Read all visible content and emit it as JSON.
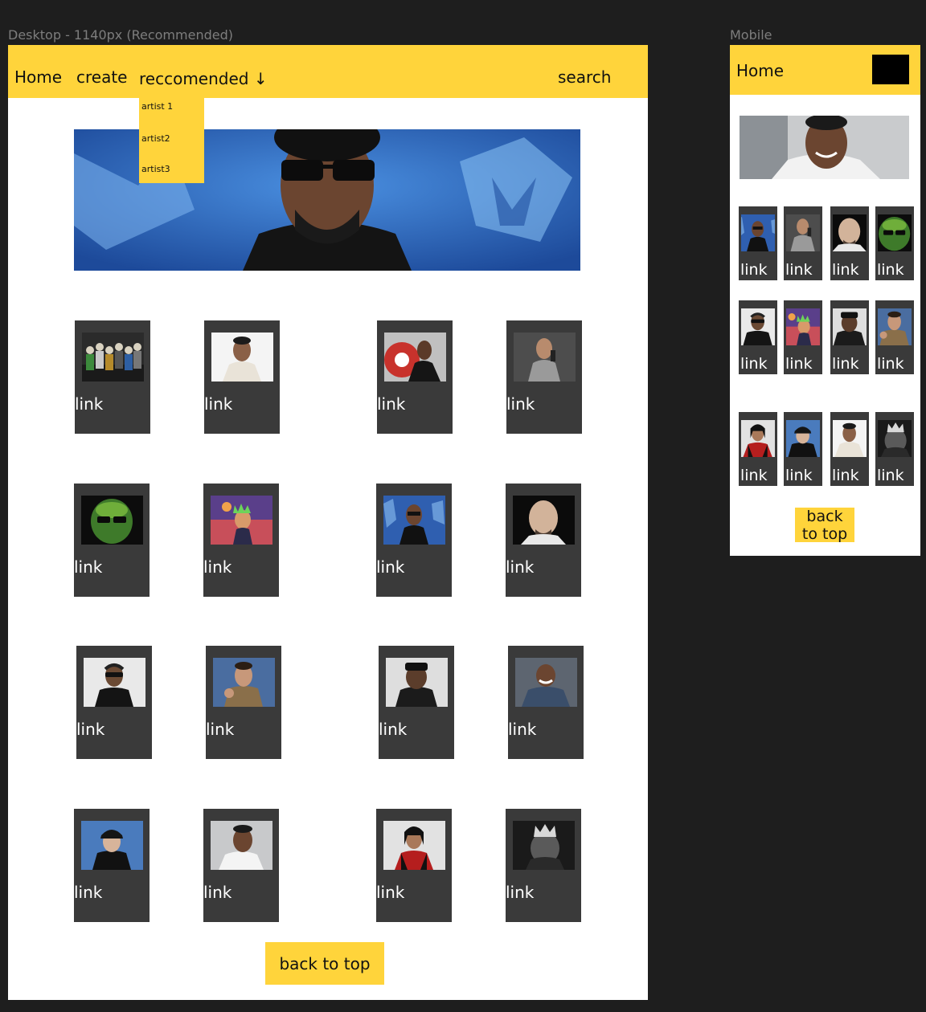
{
  "canvas": {
    "desktop_label": "Desktop - 1140px (Recommended)",
    "mobile_label": "Mobile"
  },
  "desktop": {
    "nav": {
      "home": "Home",
      "create": "create",
      "recommended": "reccomended ↓",
      "search": "search"
    },
    "dropdown": [
      "artist 1",
      "artist2",
      "artist3"
    ],
    "link_label": "link",
    "back_to_top": "back to top"
  },
  "mobile": {
    "nav": {
      "home": "Home"
    },
    "link_label": "link",
    "back_to_top_line1": "back",
    "back_to_top_line2": "to top"
  },
  "colors": {
    "accent": "#ffd43b",
    "card": "#3a3a3a",
    "canvas": "#1e1e1e"
  }
}
